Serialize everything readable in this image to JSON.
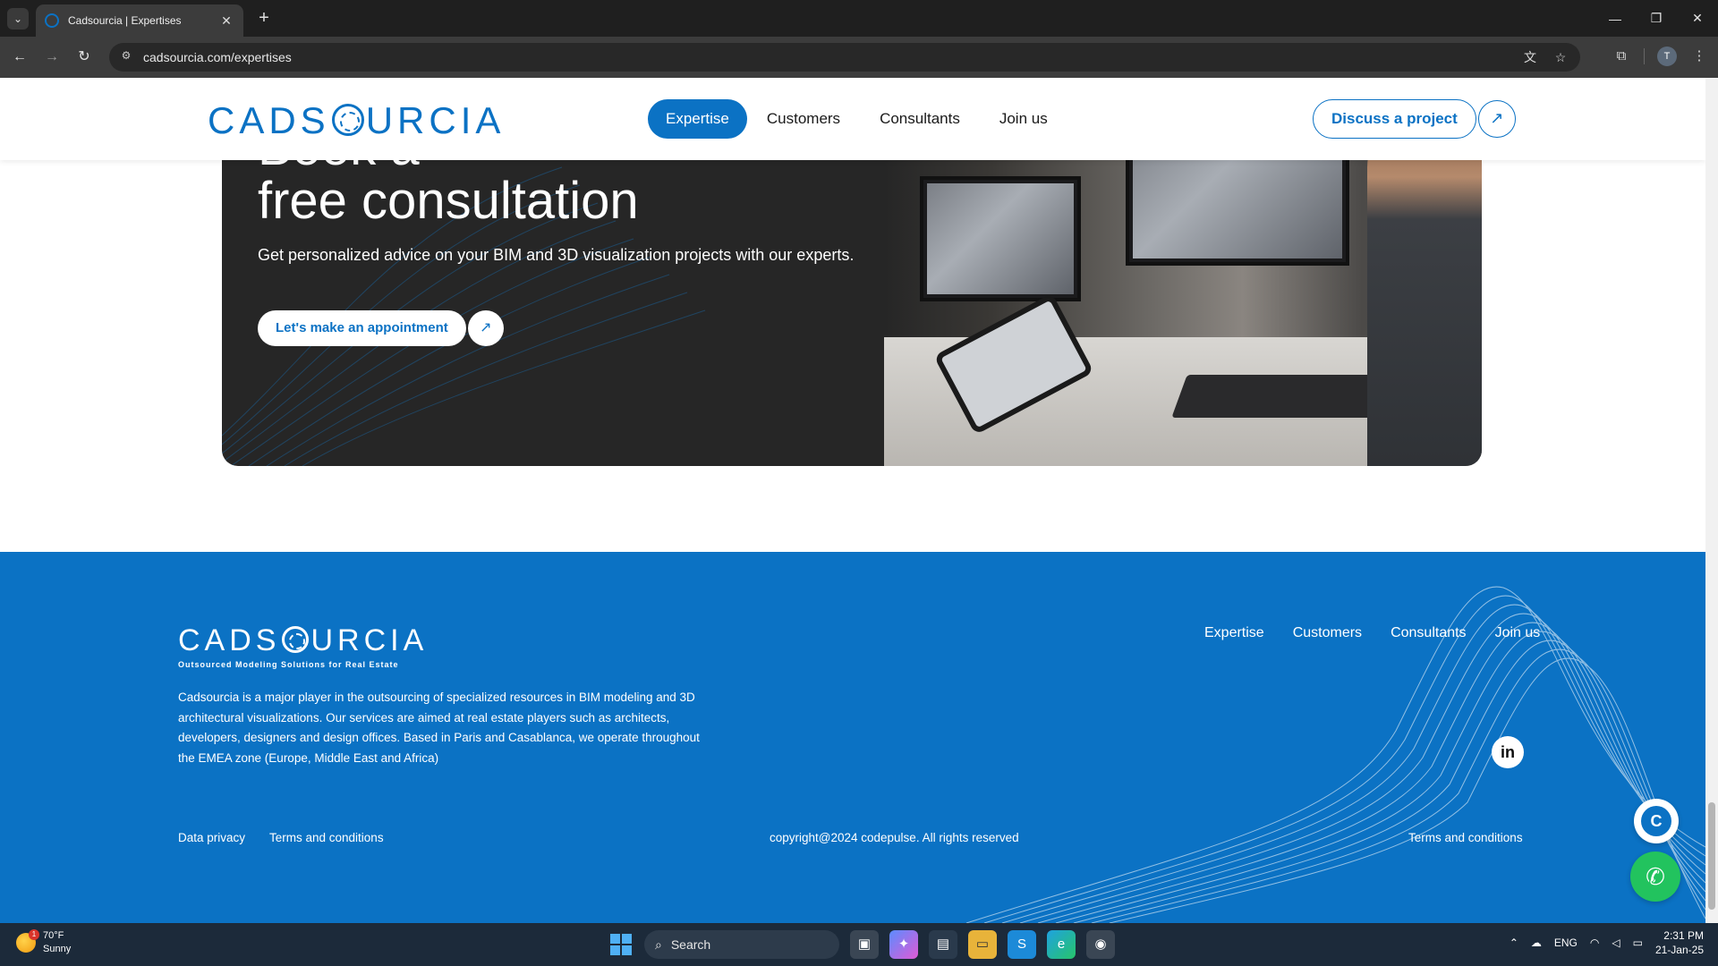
{
  "browser": {
    "tab_title": "Cadsourcia | Expertises",
    "url": "cadsourcia.com/expertises",
    "profile_initial": "T"
  },
  "header": {
    "logo_text": "CADSOURCIA",
    "nav": [
      "Expertise",
      "Customers",
      "Consultants",
      "Join us"
    ],
    "active_nav": "Expertise",
    "cta_label": "Discuss a project"
  },
  "hero": {
    "title_line1": "Book a",
    "title_line2": "free consultation",
    "subtitle": "Get personalized advice on your BIM and 3D visualization projects with our experts.",
    "button_label": "Let's make an appointment"
  },
  "footer": {
    "logo_text": "CADSOURCIA",
    "tagline": "Outsourced Modeling Solutions for Real Estate",
    "about": "Cadsourcia is a major player in the outsourcing of specialized resources in BIM modeling and 3D architectural visualizations. Our services are aimed at real estate players such as architects, developers, designers and design offices. Based in Paris and Casablanca, we operate throughout the EMEA zone (Europe, Middle East and Africa)",
    "nav": [
      "Expertise",
      "Customers",
      "Consultants",
      "Join us"
    ],
    "data_privacy": "Data privacy",
    "terms_left": "Terms and conditions",
    "copyright": "copyright@2024 codepulse. All rights reserved",
    "terms_right": "Terms and conditions"
  },
  "taskbar": {
    "weather_temp": "70°F",
    "weather_desc": "Sunny",
    "weather_badge": "1",
    "search_placeholder": "Search",
    "language": "ENG",
    "time": "2:31 PM",
    "date": "21-Jan-25"
  },
  "colors": {
    "brand_blue": "#0b72c4",
    "hero_bg": "#262626",
    "taskbar_bg": "#1c2a3a",
    "whatsapp_green": "#22c35e"
  }
}
